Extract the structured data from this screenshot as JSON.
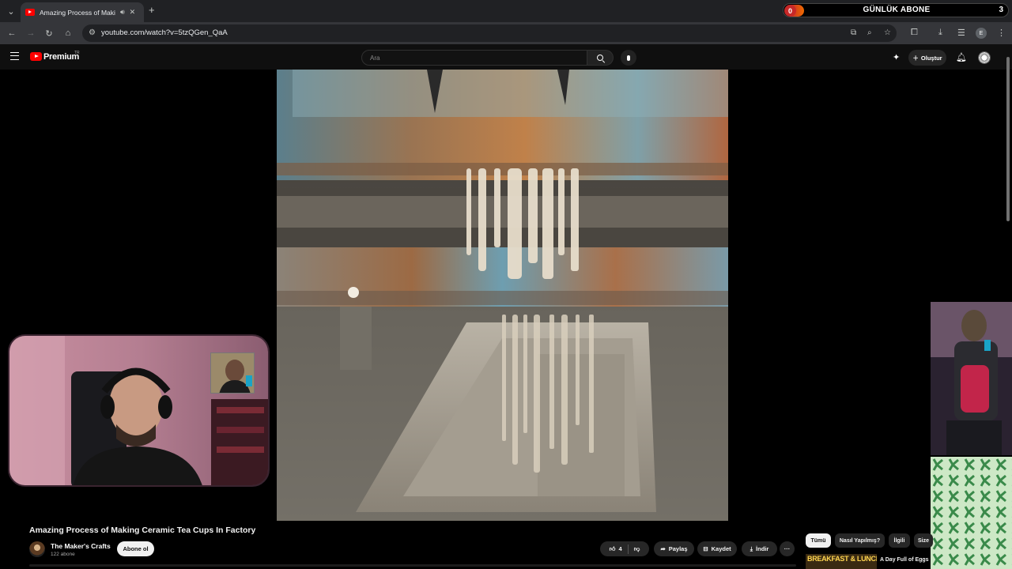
{
  "browser": {
    "tab_title": "Amazing Process of Making Ceramic Tea Cups In Factory",
    "url": "youtube.com/watch?v=5tzQGen_QaA",
    "profile_initial": "E"
  },
  "stream_overlay": {
    "left_count": "0",
    "title": "GÜNLÜK ABONE",
    "right_count": "3",
    "progress": 0.0
  },
  "masthead": {
    "logo_text": "Premium",
    "region": "TR",
    "search_placeholder": "Ara",
    "create_label": "Oluştur"
  },
  "video": {
    "title": "Amazing Process of Making Ceramic Tea Cups In Factory",
    "channel_name": "The Maker's Crafts",
    "subscribers": "122 abone",
    "subscribe_label": "Abone ol",
    "like_count": "4",
    "share_label": "Paylaş",
    "save_label": "Kaydet",
    "download_label": "İndir",
    "more_label": "···"
  },
  "chips": [
    "Tümü",
    "Nasıl Yapılmış?",
    "İlgili",
    "Size"
  ],
  "recommendation": {
    "thumb_text": "BREAKFAST & LUNCH",
    "title": "A Day Full of Eggs | Cooking Breakfast"
  },
  "colors": {
    "youtube_red": "#ff0000",
    "background": "#0f0f0f",
    "chip_bg": "#272727"
  }
}
